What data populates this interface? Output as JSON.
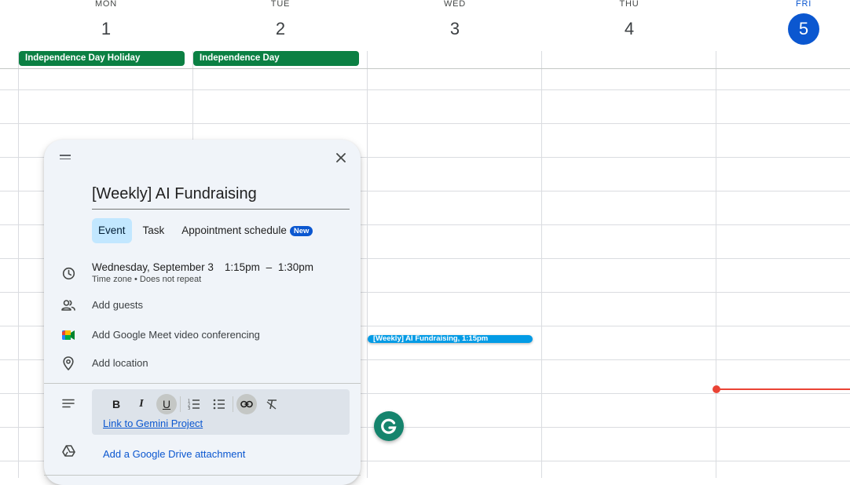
{
  "calendar": {
    "days": [
      {
        "name": "MON",
        "number": "1"
      },
      {
        "name": "TUE",
        "number": "2"
      },
      {
        "name": "WED",
        "number": "3"
      },
      {
        "name": "THU",
        "number": "4"
      },
      {
        "name": "FRI",
        "number": "5",
        "today": true
      }
    ],
    "all_day_events": [
      {
        "label": "Independence Day Holiday",
        "color": "#0b8043"
      },
      {
        "label": "Independence Day",
        "color": "#0b8043"
      }
    ],
    "timed_event": {
      "label": "[Weekly] AI Fundraising, 1:15pm",
      "color": "#039be5"
    },
    "today_color": "#0b57d0",
    "current_time_color": "#ea4335"
  },
  "dialog": {
    "title_value": "[Weekly] AI Fundraising",
    "tabs": [
      {
        "label": "Event",
        "active": true
      },
      {
        "label": "Task",
        "active": false
      },
      {
        "label": "Appointment schedule",
        "active": false,
        "badge": "New"
      }
    ],
    "datetime": {
      "date": "Wednesday, September 3",
      "start": "1:15pm",
      "separator": "–",
      "end": "1:30pm",
      "sub": "Time zone • Does not repeat"
    },
    "add_guests": "Add guests",
    "add_meet": "Add Google Meet video conferencing",
    "add_location": "Add location",
    "toolbar": {
      "bold": "B",
      "italic": "I",
      "underline": "U"
    },
    "description_link": "Link to Gemini Project",
    "drive_attachment": "Add a Google Drive attachment",
    "icons": [
      "drag-handle-icon",
      "close-icon",
      "clock-icon",
      "guests-icon",
      "google-meet-icon",
      "location-pin-icon",
      "description-icon",
      "numbered-list-icon",
      "bulleted-list-icon",
      "link-icon",
      "clear-formatting-icon",
      "google-drive-icon",
      "grammarly-icon"
    ]
  }
}
